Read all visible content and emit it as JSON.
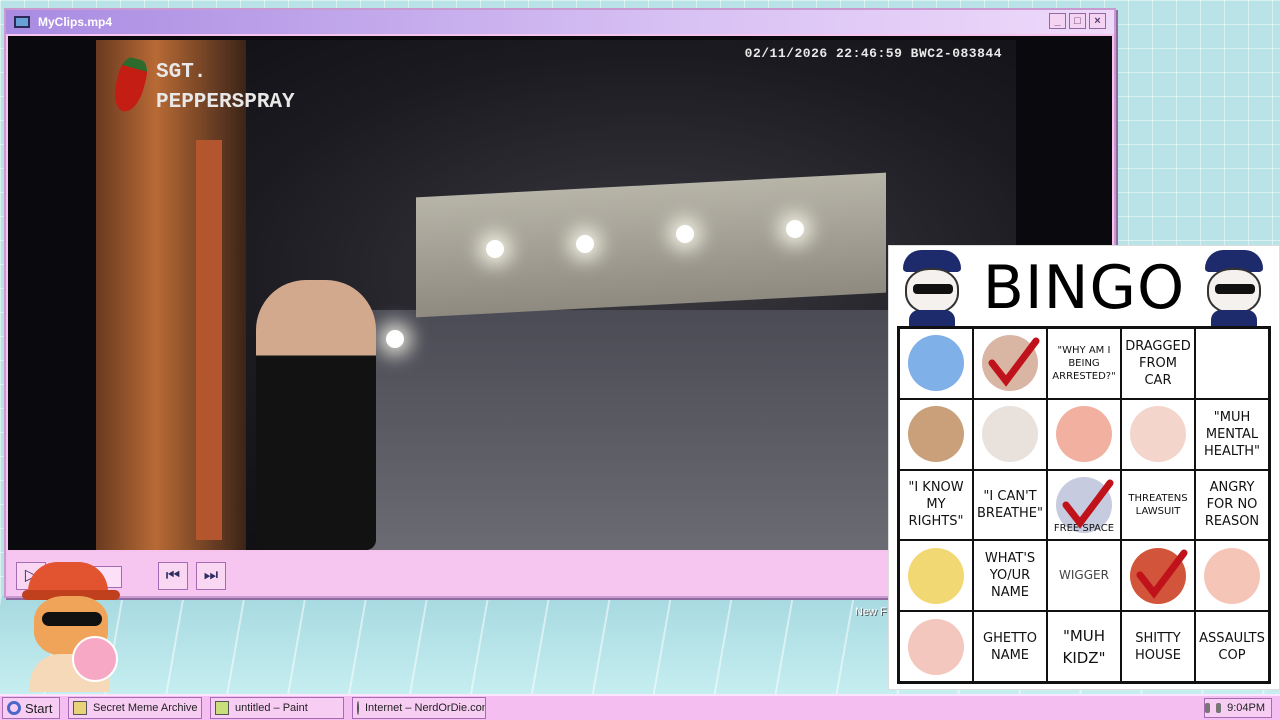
{
  "window": {
    "title": "MyClips.mp4",
    "minimize_icon": "minimize-icon",
    "maximize_icon": "maximize-icon",
    "close_icon": "close-icon"
  },
  "video": {
    "brand_line1": "SGT.",
    "brand_line2": "PEPPERSPRAY",
    "timestamp": "02/11/2026 22:46:59 BWC2-083844"
  },
  "player_controls": {
    "play_icon": "play-icon",
    "prev_icon": "skip-back-icon",
    "next_icon": "skip-forward-icon",
    "progress": 0.55
  },
  "desktop": {
    "icon_label": "New F"
  },
  "bingo": {
    "title": "BINGO",
    "cells": [
      {
        "kind": "image",
        "icon": "cat-sticker-icon",
        "color": "#7fb0e8",
        "marked": false
      },
      {
        "kind": "image",
        "icon": "face-photo-icon",
        "color": "#d9b5a3",
        "marked": true
      },
      {
        "kind": "text",
        "text": "\"WHY AM I BEING ARRESTED?\"",
        "style": "small",
        "marked": false
      },
      {
        "kind": "text",
        "text": "DRAGGED FROM CAR",
        "style": "normal",
        "marked": false
      },
      {
        "kind": "image",
        "icon": "chain-cat-icon",
        "color": "#ffffff",
        "marked": false
      },
      {
        "kind": "image",
        "icon": "curly-hair-cat-icon",
        "color": "#c9a07a",
        "marked": false
      },
      {
        "kind": "image",
        "icon": "steering-wheel-cat-icon",
        "color": "#e9e2dc",
        "marked": false
      },
      {
        "kind": "image",
        "icon": "red-hair-cat-icon",
        "color": "#f2b0a0",
        "marked": false
      },
      {
        "kind": "image",
        "icon": "sad-cat-icon",
        "color": "#f3d5cc",
        "marked": false
      },
      {
        "kind": "text",
        "text": "\"MUH MENTAL HEALTH\"",
        "style": "normal",
        "marked": false
      },
      {
        "kind": "text",
        "text": "\"I KNOW MY RIGHTS\"",
        "style": "normal",
        "marked": false
      },
      {
        "kind": "text",
        "text": "\"I CAN'T BREATHE\"",
        "style": "normal",
        "marked": false
      },
      {
        "kind": "free",
        "text": "FREE SPACE",
        "icon": "flag-cat-icon",
        "color": "#c7cbe0",
        "marked": true
      },
      {
        "kind": "text",
        "text": "THREATENS LAWSUIT",
        "style": "small",
        "marked": false
      },
      {
        "kind": "text",
        "text": "ANGRY FOR NO REASON",
        "style": "normal",
        "marked": false
      },
      {
        "kind": "image",
        "icon": "blonde-cat-icon",
        "color": "#f2d873",
        "marked": false
      },
      {
        "kind": "text",
        "text": "WHAT'S YO/UR NAME",
        "style": "normal",
        "marked": false
      },
      {
        "kind": "text",
        "text": "WIGGER",
        "style": "plain",
        "marked": false
      },
      {
        "kind": "image",
        "icon": "hooded-cat-icon",
        "color": "#d2543a",
        "marked": true
      },
      {
        "kind": "image",
        "icon": "flower-cat-icon",
        "color": "#f5c6b8",
        "marked": false
      },
      {
        "kind": "image",
        "icon": "chubby-cat-icon",
        "color": "#f3c7bd",
        "marked": false
      },
      {
        "kind": "text",
        "text": "GHETTO NAME",
        "style": "normal",
        "marked": false
      },
      {
        "kind": "text",
        "text": "\"MUH KIDZ\"",
        "style": "big",
        "marked": false
      },
      {
        "kind": "text",
        "text": "SHITTY HOUSE",
        "style": "normal",
        "marked": false
      },
      {
        "kind": "text",
        "text": "ASSAULTS COP",
        "style": "normal",
        "marked": false
      }
    ]
  },
  "taskbar": {
    "start_label": "Start",
    "items": [
      {
        "label": "Secret Meme Archive",
        "icon": "folder-icon",
        "color": "#e8d27a"
      },
      {
        "label": "untitled – Paint",
        "icon": "paint-icon",
        "color": "#c9e07a"
      },
      {
        "label": "Internet – NerdOrDie.com",
        "icon": "globe-icon",
        "color": "#7ab3e8"
      }
    ],
    "clock": "9:04PM"
  }
}
